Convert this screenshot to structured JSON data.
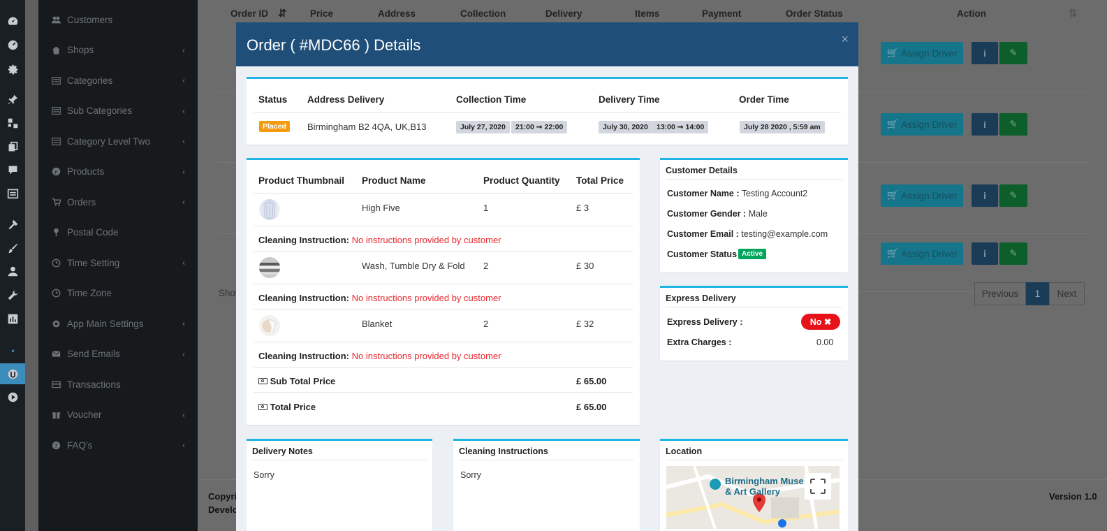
{
  "nav": {
    "items": [
      {
        "label": "Customers",
        "icon": "users-icon",
        "chev": false
      },
      {
        "label": "Shops",
        "icon": "shop-icon",
        "chev": true
      },
      {
        "label": "Categories",
        "icon": "list-icon",
        "chev": true
      },
      {
        "label": "Sub Categories",
        "icon": "list-icon",
        "chev": true
      },
      {
        "label": "Category Level Two",
        "icon": "list-icon",
        "chev": true
      },
      {
        "label": "Products",
        "icon": "product-icon",
        "chev": true
      },
      {
        "label": "Orders",
        "icon": "cart-icon",
        "chev": true
      },
      {
        "label": "Postal Code",
        "icon": "pin-icon",
        "chev": false
      },
      {
        "label": "Time Setting",
        "icon": "clock-icon",
        "chev": true
      },
      {
        "label": "Time Zone",
        "icon": "clock-icon",
        "chev": false
      },
      {
        "label": "App Main Settings",
        "icon": "gear-icon",
        "chev": true
      },
      {
        "label": "Send Emails",
        "icon": "mail-icon",
        "chev": true
      },
      {
        "label": "Transactions",
        "icon": "card-icon",
        "chev": false
      },
      {
        "label": "Voucher",
        "icon": "gift-icon",
        "chev": true
      },
      {
        "label": "FAQ's",
        "icon": "question-icon",
        "chev": true
      }
    ],
    "chevron": "‹"
  },
  "background": {
    "columns": [
      "Order ID",
      "Price",
      "Address",
      "Collection",
      "Delivery",
      "Items",
      "Payment",
      "Order Status",
      "Action"
    ],
    "assign_label": "Assign Driver",
    "show_label": "Show",
    "pager": {
      "prev": "Previous",
      "current": "1",
      "next": "Next"
    },
    "footer_copy": "Copyri",
    "footer_dev": "Develo",
    "version": "Version 1.0"
  },
  "modal": {
    "title": "Order ( #MDC66 ) Details",
    "close": "×",
    "summary": {
      "headers": [
        "Status",
        "Address Delivery",
        "Collection Time",
        "Delivery Time",
        "Order Time"
      ],
      "status": "Placed",
      "address": "Birmingham B2 4QA, UK,B13",
      "collection_date": "July 27, 2020",
      "collection_slot": "21:00 ➞ 22:00",
      "delivery_date": "July 30, 2020",
      "delivery_slot": "13:00 ➞ 14:00",
      "order_time": "July 28 2020 , 5:59 am"
    },
    "products": {
      "headers": [
        "Product Thumbnail",
        "Product Name",
        "Product Quantity",
        "Total Price"
      ],
      "rows": [
        {
          "name": "High Five",
          "qty": "1",
          "price": "£ 3"
        },
        {
          "name": "Wash, Tumble Dry & Fold",
          "qty": "2",
          "price": "£ 30"
        },
        {
          "name": "Blanket",
          "qty": "2",
          "price": "£ 32"
        }
      ],
      "instruction_label": "Cleaning Instruction:",
      "instruction_value": "No instructions provided by customer",
      "subtotal_label": "Sub Total Price",
      "subtotal": "£ 65.00",
      "total_label": "Total Price",
      "total": "£ 65.00"
    },
    "customer": {
      "title": "Customer Details",
      "name_label": "Customer Name :",
      "name": "Testing Account2",
      "gender_label": "Customer Gender :",
      "gender": "Male",
      "email_label": "Customer Email :",
      "email": "testing@example.com",
      "status_label": "Customer Status :",
      "status": "Active"
    },
    "express": {
      "title": "Express Delivery",
      "label": "Express Delivery :",
      "value": "No ✖",
      "charges_label": "Extra Charges :",
      "charges": "0.00"
    },
    "delivery_notes": {
      "title": "Delivery Notes",
      "text": "Sorry"
    },
    "cleaning_instructions": {
      "title": "Cleaning Instructions",
      "text": "Sorry"
    },
    "location": {
      "title": "Location",
      "map_label1": "Birmingham Muse",
      "map_label2": "& Art Gallery"
    }
  },
  "colors": {
    "accent": "#1fb6e6",
    "header": "#1f4e79",
    "placed": "#f39c12",
    "active": "#00a65a",
    "no": "#e8111a"
  }
}
